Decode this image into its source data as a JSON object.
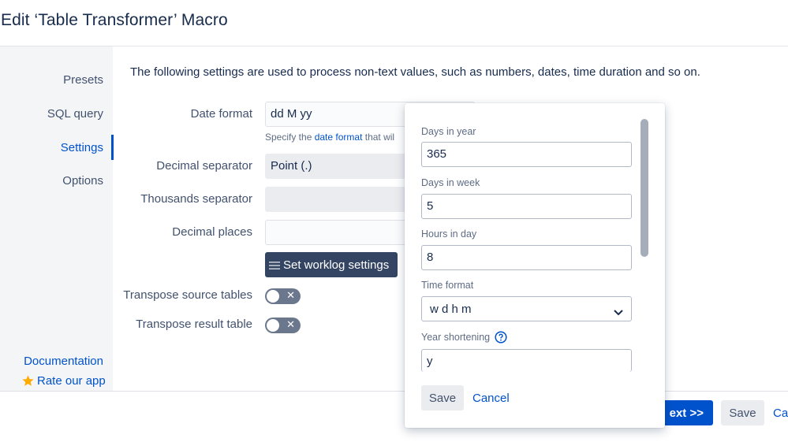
{
  "dialog": {
    "title": "Edit ‘Table Transformer’ Macro"
  },
  "sidebar": {
    "items": [
      {
        "label": "Presets"
      },
      {
        "label": "SQL query"
      },
      {
        "label": "Settings",
        "active": true
      },
      {
        "label": "Options"
      }
    ],
    "documentation": "Documentation",
    "rate": "Rate our app"
  },
  "main": {
    "intro": "The following settings are used to process non-text values, such as numbers, dates, time duration and so on.",
    "date_format": {
      "label": "Date format",
      "value": "dd M yy",
      "hint_prefix": "Specify the ",
      "hint_link": "date format",
      "hint_suffix": " that wil"
    },
    "decimal_separator": {
      "label": "Decimal separator",
      "value": "Point (.)"
    },
    "thousands_separator": {
      "label": "Thousands separator",
      "value": ""
    },
    "decimal_places": {
      "label": "Decimal places",
      "value": ""
    },
    "worklog_button": "Set worklog settings",
    "transpose_source": {
      "label": "Transpose source tables",
      "enabled": false
    },
    "transpose_result": {
      "label": "Transpose result table",
      "enabled": false
    }
  },
  "footer": {
    "next": "ext >>",
    "save": "Save",
    "cancel": "Car"
  },
  "worklog_popup": {
    "days_in_year": {
      "label": "Days in year",
      "value": "365"
    },
    "days_in_week": {
      "label": "Days in week",
      "value": "5"
    },
    "hours_in_day": {
      "label": "Hours in day",
      "value": "8"
    },
    "time_format": {
      "label": "Time format",
      "value": "w d h m"
    },
    "year_shortening": {
      "label": "Year shortening",
      "value": "y"
    },
    "save": "Save",
    "cancel": "Cancel"
  },
  "colors": {
    "accent": "#0052cc",
    "dark_button": "#344563",
    "toggle_off": "#6b778c"
  },
  "icons": {
    "star": "star-icon",
    "menu": "menu-icon",
    "help": "help-icon",
    "chevron": "chevron-down-icon",
    "close": "close-icon"
  }
}
